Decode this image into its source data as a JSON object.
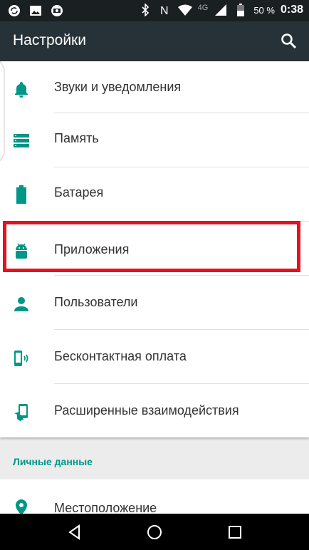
{
  "status_bar": {
    "network": "4G",
    "battery": "50 %",
    "time": "0:38"
  },
  "app_bar": {
    "title": "Настройки"
  },
  "settings_items": [
    {
      "label": "Звуки и уведомления",
      "icon": "bell-icon"
    },
    {
      "label": "Память",
      "icon": "storage-icon"
    },
    {
      "label": "Батарея",
      "icon": "battery-icon"
    },
    {
      "label": "Приложения",
      "icon": "android-icon"
    },
    {
      "label": "Пользователи",
      "icon": "person-icon"
    },
    {
      "label": "Бесконтактная оплата",
      "icon": "tap-pay-icon"
    },
    {
      "label": "Расширенные взаимодействия",
      "icon": "gesture-icon"
    }
  ],
  "personal_section": {
    "header": "Личные данные",
    "items": [
      {
        "label": "Местоположение",
        "icon": "location-icon"
      }
    ]
  },
  "colors": {
    "accent": "#009688",
    "app_bar": "#263238",
    "highlight": "#e8101e"
  }
}
